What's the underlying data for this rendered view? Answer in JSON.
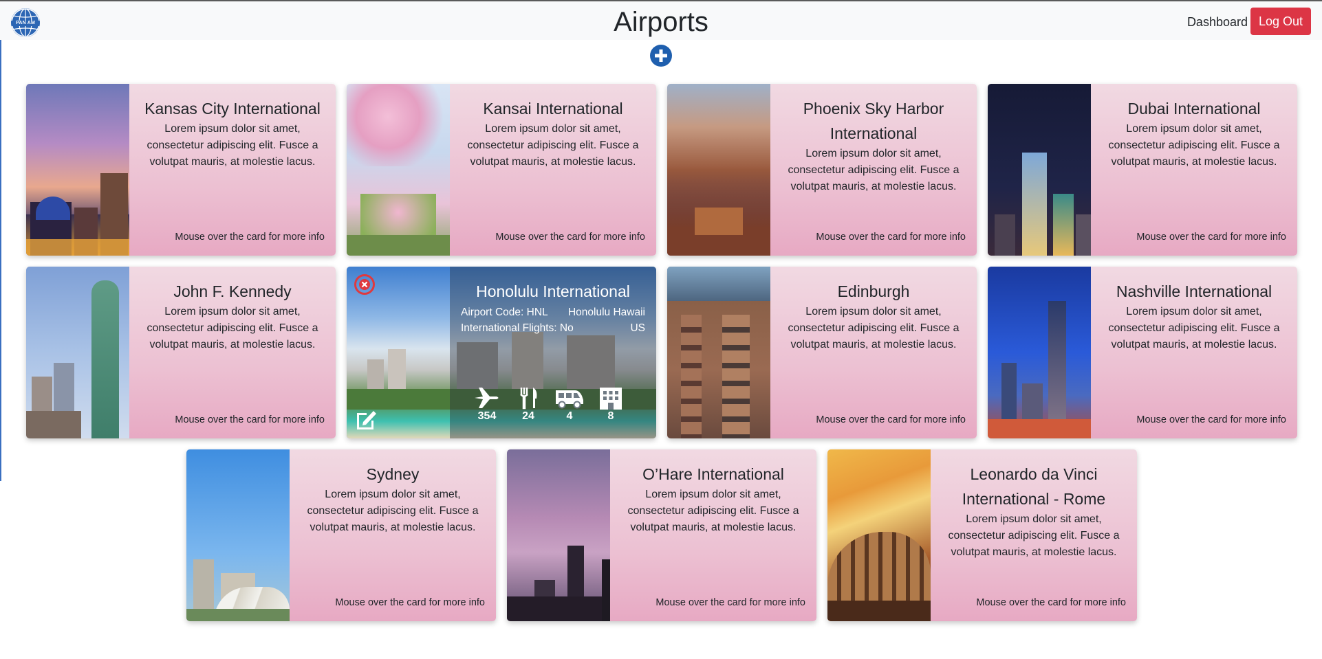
{
  "header": {
    "logo_icon": "pan-am-globe-icon",
    "logo_text": "PAN AM",
    "title": "Airports",
    "nav_dashboard": "Dashboard",
    "logout_label": "Log Out",
    "add_icon": "plus-circle-icon"
  },
  "cards": [
    {
      "title": "Kansas City International",
      "text": "Lorem ipsum dolor sit amet, consectetur adipiscing elit. Fusce a volutpat mauris, at molestie lacus.",
      "hint": "Mouse over the card for more info"
    },
    {
      "title": "Kansai International",
      "text": "Lorem ipsum dolor sit amet, consectetur adipiscing elit. Fusce a volutpat mauris, at molestie lacus.",
      "hint": "Mouse over the card for more info"
    },
    {
      "title": "Phoenix Sky Harbor International",
      "text": "Lorem ipsum dolor sit amet, consectetur adipiscing elit. Fusce a volutpat mauris, at molestie lacus.",
      "hint": "Mouse over the card for more info"
    },
    {
      "title": "Dubai International",
      "text": "Lorem ipsum dolor sit amet, consectetur adipiscing elit. Fusce a volutpat mauris, at molestie lacus.",
      "hint": "Mouse over the card for more info"
    },
    {
      "title": "John F. Kennedy",
      "text": "Lorem ipsum dolor sit amet, consectetur adipiscing elit. Fusce a volutpat mauris, at molestie lacus.",
      "hint": "Mouse over the card for more info"
    },
    {
      "title": "Honolulu International",
      "text": "",
      "hint": ""
    },
    {
      "title": "Edinburgh",
      "text": "Lorem ipsum dolor sit amet, consectetur adipiscing elit. Fusce a volutpat mauris, at molestie lacus.",
      "hint": "Mouse over the card for more info"
    },
    {
      "title": "Nashville International",
      "text": "Lorem ipsum dolor sit amet, consectetur adipiscing elit. Fusce a volutpat mauris, at molestie lacus.",
      "hint": "Mouse over the card for more info"
    },
    {
      "title": "Sydney",
      "text": "Lorem ipsum dolor sit amet, consectetur adipiscing elit. Fusce a volutpat mauris, at molestie lacus.",
      "hint": "Mouse over the card for more info"
    },
    {
      "title": "O’Hare International",
      "text": "Lorem ipsum dolor sit amet, consectetur adipiscing elit. Fusce a volutpat mauris, at molestie lacus.",
      "hint": "Mouse over the card for more info"
    },
    {
      "title": "Leonardo da Vinci International - Rome",
      "text": "Lorem ipsum dolor sit amet, consectetur adipiscing elit. Fusce a volutpat mauris, at molestie lacus.",
      "hint": "Mouse over the card for more info"
    }
  ],
  "expanded": {
    "title": "Honolulu International",
    "airport_code": "Airport Code: HNL",
    "city": "Honolulu Hawaii",
    "international": "International Flights: No",
    "country": "US",
    "stats": [
      {
        "icon": "plane-icon",
        "value": "354"
      },
      {
        "icon": "utensils-icon",
        "value": "24"
      },
      {
        "icon": "shuttle-van-icon",
        "value": "4"
      },
      {
        "icon": "hotel-icon",
        "value": "8"
      }
    ],
    "delete_icon": "delete-circle-icon",
    "edit_icon": "edit-icon"
  },
  "colors": {
    "logout": "#dc3545",
    "add": "#1f5fae",
    "delete": "#e0393e",
    "card_gradient_top": "#f1d9e2",
    "card_gradient_bottom": "#e7a9c3"
  }
}
